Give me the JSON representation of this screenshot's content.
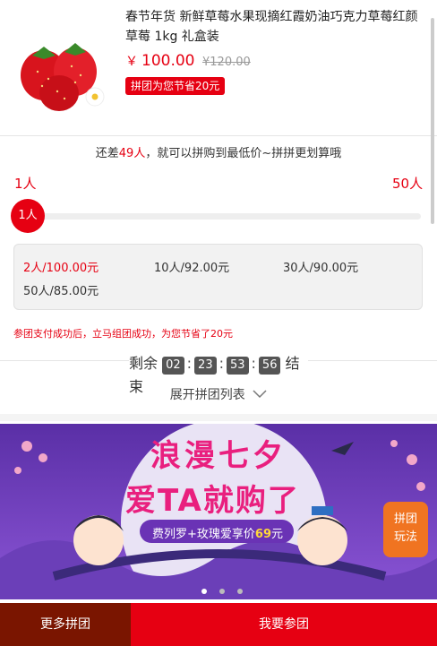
{
  "product": {
    "title": "春节年货 新鲜草莓水果现摘红霞奶油巧克力草莓红颜草莓 1kg 礼盒装",
    "currency": "￥",
    "price": "100.00",
    "old_price": "¥120.00",
    "save_badge": "拼团为您节省20元"
  },
  "progress": {
    "hint_prefix": "还差",
    "hint_count": "49人",
    "hint_suffix": "，就可以拼购到最低价~拼拼更划算哦",
    "min_label": "1人",
    "max_label": "50人",
    "knob_label": "1人",
    "fraction": 0.0
  },
  "tiers": [
    {
      "label": "2人/100.00元",
      "active": true
    },
    {
      "label": "10人/92.00元",
      "active": false
    },
    {
      "label": "30人/90.00元",
      "active": false
    },
    {
      "label": "50人/85.00元",
      "active": false
    }
  ],
  "notice": "参团支付成功后，立马组团成功，为您节省了20元",
  "countdown": {
    "prefix": "剩余",
    "days": "02",
    "hours": "23",
    "minutes": "53",
    "seconds": "56",
    "suffix": "结束"
  },
  "expand_label": "展开拼团列表",
  "banner": {
    "headline_1": "浪漫七夕",
    "headline_2": "爱TA就购了",
    "promo_prefix": "费列罗+玫瑰爱享价",
    "promo_price": "69",
    "promo_unit": "元",
    "slide_count": 3,
    "active_slide": 0
  },
  "float_button": {
    "line1": "拼团",
    "line2": "玩法"
  },
  "bottom_bar": {
    "more_label": "更多拼团",
    "join_label": "我要参团"
  },
  "colors": {
    "accent": "#e60012",
    "dark_red": "#7a1500",
    "orange": "#f07421",
    "banner_purple": "#7b4ec7"
  }
}
